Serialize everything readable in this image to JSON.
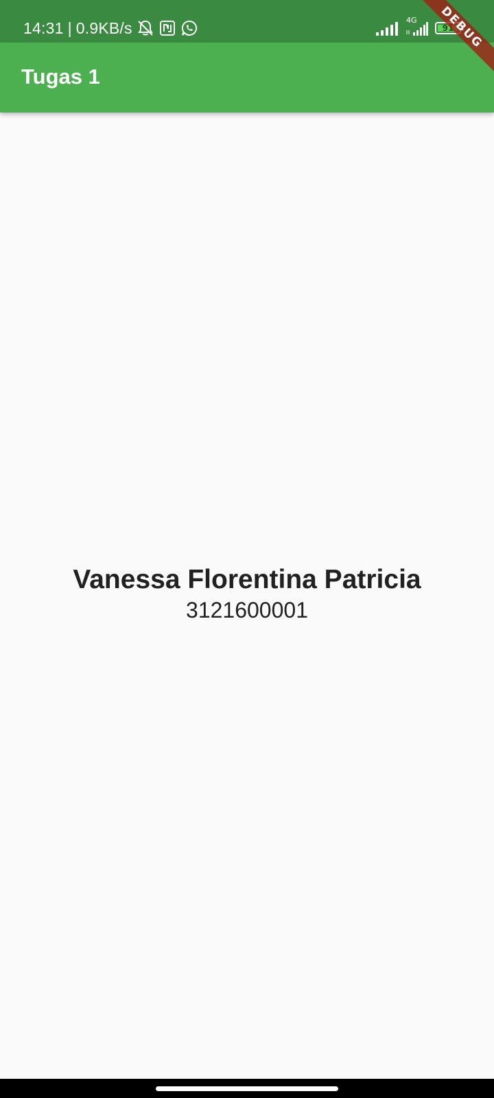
{
  "status_bar": {
    "time": "14:31",
    "speed": "0.9KB/s",
    "separator": "|",
    "icons": [
      "bell-off-icon",
      "nfc-icon",
      "whatsapp-icon",
      "signal-icon",
      "signal-4g-icon",
      "battery-icon"
    ],
    "network_type": "4G",
    "battery_level": "91"
  },
  "app_bar": {
    "title": "Tugas 1"
  },
  "debug_banner": {
    "label": "DEBUG"
  },
  "main": {
    "name": "Vanessa Florentina Patricia",
    "student_id": "3121600001"
  },
  "colors": {
    "status_bar": "#3b8a41",
    "app_bar": "#4caf50",
    "background": "#fafafa",
    "text": "#212121"
  }
}
